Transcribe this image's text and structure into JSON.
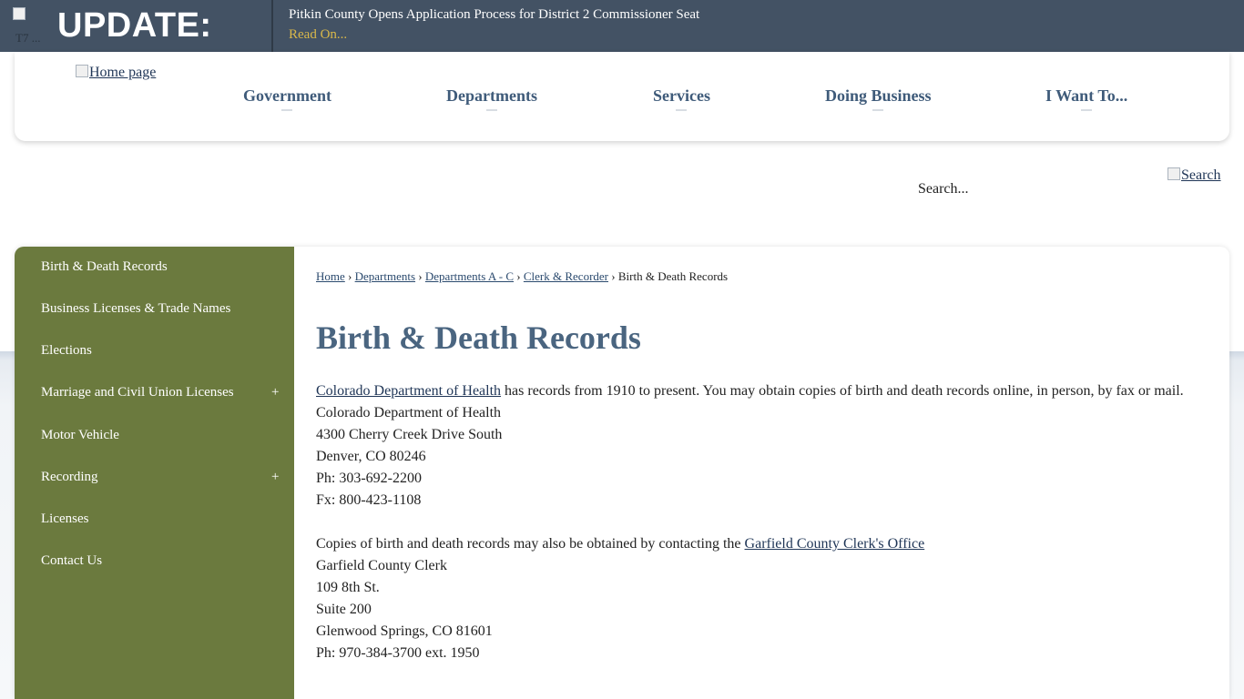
{
  "alert": {
    "logo_alt": "T7 ...",
    "title": "UPDATE:",
    "headline": "Pitkin County Opens Application Process for District 2 Commissioner Seat",
    "link": "Read On..."
  },
  "header": {
    "home_alt": "Home page",
    "nav": [
      "Government",
      "Departments",
      "Services",
      "Doing Business",
      "I Want To..."
    ]
  },
  "search": {
    "placeholder": "Search...",
    "button_alt": "Search"
  },
  "sidebar": {
    "items": [
      {
        "label": "Birth & Death Records",
        "expandable": false
      },
      {
        "label": "Business Licenses & Trade Names",
        "expandable": false
      },
      {
        "label": "Elections",
        "expandable": false
      },
      {
        "label": "Marriage and Civil Union Licenses",
        "expandable": true
      },
      {
        "label": "Motor Vehicle",
        "expandable": false
      },
      {
        "label": "Recording",
        "expandable": true
      },
      {
        "label": "Licenses",
        "expandable": false
      },
      {
        "label": "Contact Us",
        "expandable": false
      }
    ],
    "expand_symbol": "+"
  },
  "breadcrumb": {
    "links": [
      "Home",
      "Departments",
      "Departments A - C",
      "Clerk & Recorder"
    ],
    "separator": "›",
    "current": "Birth & Death Records"
  },
  "content": {
    "title": "Birth & Death Records",
    "p1_link": "Colorado Department of Health",
    "p1_text": " has records from 1910 to present. You may obtain copies of birth and death records online, in person, by fax or mail.",
    "address1": [
      "Colorado Department of Health",
      "4300 Cherry Creek Drive South",
      "Denver, CO 80246",
      "Ph: 303-692-2200",
      "Fx: 800-423-1108"
    ],
    "p2_text": "Copies of birth and death records may also be obtained by contacting the ",
    "p2_link": "Garfield County Clerk's Office",
    "address2": [
      "Garfield County Clerk",
      "109 8th St.",
      "Suite 200",
      "Glenwood Springs, CO 81601",
      "Ph: 970-384-3700 ext. 1950"
    ]
  }
}
